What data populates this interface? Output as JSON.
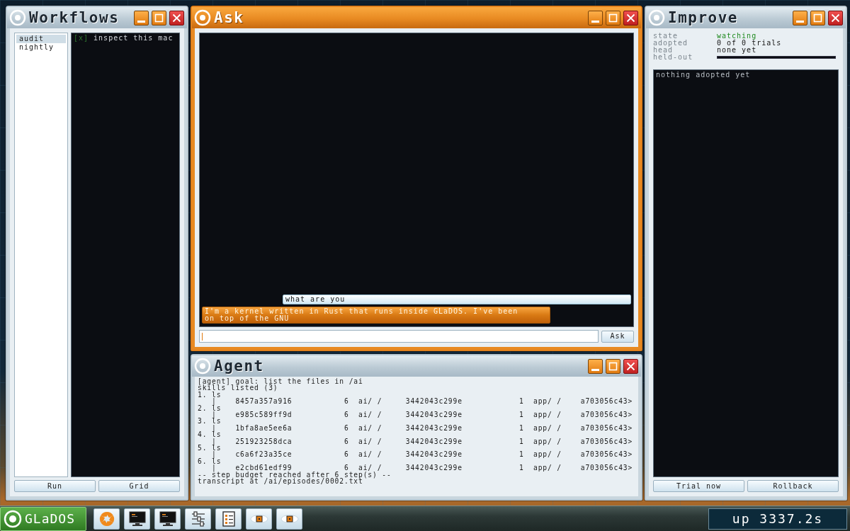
{
  "workflows": {
    "title": "Workflows",
    "focused": false,
    "items": [
      {
        "name": "audit",
        "selected": true
      },
      {
        "name": "nightly",
        "selected": false
      }
    ],
    "tasks": [
      {
        "mark": "[x]",
        "text": "inspect this mac",
        "done": true
      }
    ],
    "buttons": [
      "Run",
      "Grid"
    ]
  },
  "ask": {
    "title": "Ask",
    "focused": true,
    "messages": [
      {
        "kind": "question",
        "lines": [
          "what are you"
        ]
      },
      {
        "kind": "reply",
        "lines": [
          "I'm a kernel written in Rust that runs inside GLaDOS. I've been",
          "on top of the GNU"
        ]
      }
    ],
    "input": {
      "focused": true
    },
    "button": "Ask"
  },
  "agent": {
    "title": "Agent",
    "focused": false,
    "lines": [
      "[agent] goal: list the files in /ai",
      "skills listed (3)",
      "1. ls",
      "   |    8457a357a916           6  ai/ /     3442043c299e            1  app/ /    a703056c43>",
      "2. ls",
      "   |    e985c589ff9d           6  ai/ /     3442043c299e            1  app/ /    a703056c43>",
      "3. ls",
      "   |    1bfa8ae5ee6a           6  ai/ /     3442043c299e            1  app/ /    a703056c43>",
      "4. ls",
      "   |    251923258dca           6  ai/ /     3442043c299e            1  app/ /    a703056c43>",
      "5. ls",
      "   |    c6a6f23a35ce           6  ai/ /     3442043c299e            1  app/ /    a703056c43>",
      "6. ls",
      "   |    e2cbd61edf99           6  ai/ /     3442043c299e            1  app/ /    a703056c43>",
      "-- step budget reached after 6 step(s) --",
      "transcript at /ai/episodes/0002.txt"
    ]
  },
  "improve": {
    "title": "Improve",
    "focused": false,
    "fields": [
      {
        "label": "state",
        "value": "watching",
        "kind": "status"
      },
      {
        "label": "adopted",
        "value": "0 of 0 trials",
        "kind": "text"
      },
      {
        "label": "head",
        "value": "none yet",
        "kind": "text"
      },
      {
        "label": "held-out",
        "kind": "bar"
      }
    ],
    "log": [
      "nothing adopted yet"
    ],
    "buttons": [
      "Trial now",
      "Rollback"
    ]
  },
  "taskbar": {
    "start": "GLaDOS",
    "launchers": [
      {
        "kind": "aperture"
      },
      {
        "kind": "terminal"
      },
      {
        "kind": "terminal"
      },
      {
        "kind": "sliders"
      },
      {
        "kind": "checklist"
      },
      {
        "kind": "eye"
      },
      {
        "kind": "eye"
      }
    ],
    "uptime": "up 3337.2s"
  }
}
